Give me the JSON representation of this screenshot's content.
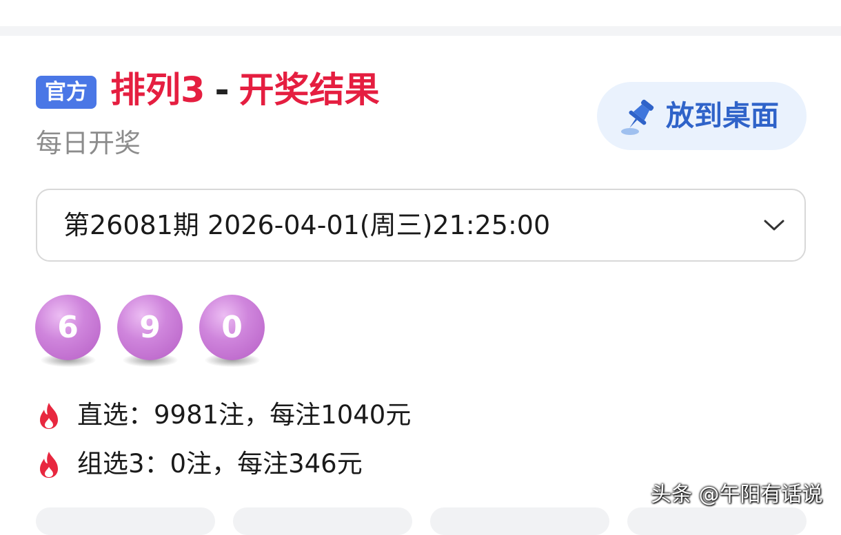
{
  "header": {
    "badge": "官方",
    "title_main": "排列3",
    "title_dash": "-",
    "title_suffix": "开奖结果",
    "subtitle": "每日开奖",
    "pin_button_label": "放到桌面"
  },
  "period_select": {
    "selected": "第26081期 2026-04-01(周三)21:25:00"
  },
  "balls": [
    "6",
    "9",
    "0"
  ],
  "prizes": [
    {
      "text": "直选：9981注，每注1040元"
    },
    {
      "text": "组选3：0注，每注346元"
    }
  ],
  "watermark": "头条 @午阳有话说",
  "colors": {
    "accent_red": "#e51e40",
    "badge_blue": "#4a77e6",
    "pin_button_bg": "#eaf2fd",
    "ball_purple": "#c46fd3"
  },
  "icons": {
    "pin": "pushpin-icon",
    "chevron": "chevron-down-icon",
    "fire": "fire-icon"
  }
}
